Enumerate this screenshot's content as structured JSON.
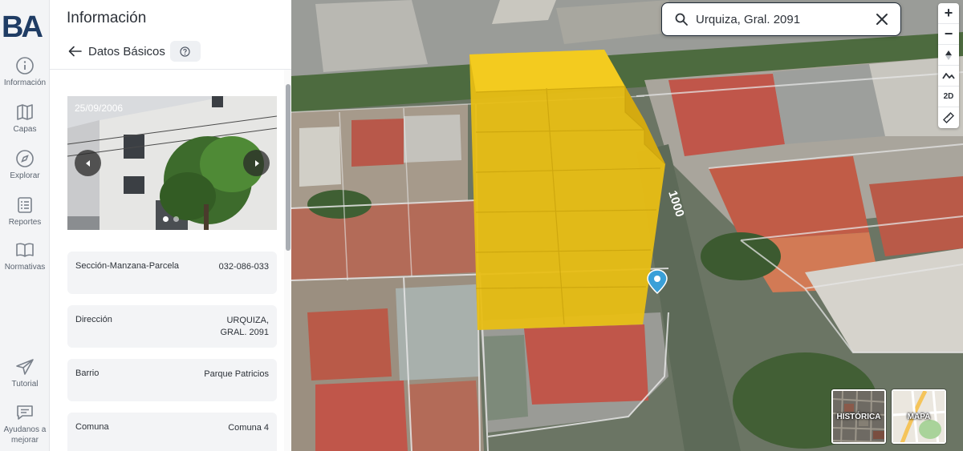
{
  "brand": {
    "logo_text": "BA",
    "color": "#1f3c64"
  },
  "sidebar": {
    "items": [
      {
        "label": "Información",
        "icon": "info-icon"
      },
      {
        "label": "Capas",
        "icon": "map-layers-icon"
      },
      {
        "label": "Explorar",
        "icon": "compass-icon"
      },
      {
        "label": "Reportes",
        "icon": "list-icon"
      },
      {
        "label": "Normativas",
        "icon": "book-icon"
      },
      {
        "label": "Tutorial",
        "icon": "paper-plane-icon"
      },
      {
        "label": "Ayudanos a mejorar",
        "icon": "feedback-icon"
      }
    ]
  },
  "panel": {
    "title": "Información",
    "subtitle": "Datos Básicos",
    "help_icon": "question-circle-icon",
    "photo": {
      "date": "25/09/2006",
      "slide_count": 2,
      "active_slide": 1
    },
    "fields": [
      {
        "label": "Sección-Manzana-Parcela",
        "value": "032-086-033"
      },
      {
        "label": "Dirección",
        "value": "URQUIZA, GRAL. 2091"
      },
      {
        "label": "Barrio",
        "value": "Parque Patricios"
      },
      {
        "label": "Comuna",
        "value": "Comuna 4"
      }
    ]
  },
  "map": {
    "search_value": "Urquiza, Gral. 2091",
    "street_label": "1000",
    "controls": {
      "zoom_in": "+",
      "zoom_out": "−",
      "mode_2d": "2D"
    },
    "basemaps": [
      {
        "label": "HISTÓRICA"
      },
      {
        "label": "MAPA"
      }
    ],
    "colors": {
      "volume": "#f1c40f",
      "marker": "#3aa0d8"
    }
  }
}
